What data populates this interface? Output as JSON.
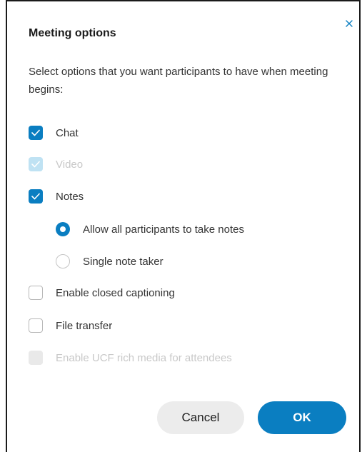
{
  "dialog": {
    "title": "Meeting options",
    "description": "Select options that you want participants to have when meeting begins:",
    "close_icon": "close-icon",
    "accent_color": "#0a7ec1"
  },
  "options": {
    "chat": {
      "label": "Chat",
      "checked": true,
      "disabled": false
    },
    "video": {
      "label": "Video",
      "checked": true,
      "disabled": true
    },
    "notes": {
      "label": "Notes",
      "checked": true,
      "disabled": false
    },
    "notes_mode": {
      "all": {
        "label": "Allow all participants to take notes",
        "selected": true
      },
      "single": {
        "label": "Single note taker",
        "selected": false
      }
    },
    "captioning": {
      "label": "Enable closed captioning",
      "checked": false,
      "disabled": false
    },
    "file_transfer": {
      "label": "File transfer",
      "checked": false,
      "disabled": false
    },
    "ucf": {
      "label": "Enable UCF rich media for attendees",
      "checked": false,
      "disabled": true
    }
  },
  "buttons": {
    "cancel": "Cancel",
    "ok": "OK"
  }
}
